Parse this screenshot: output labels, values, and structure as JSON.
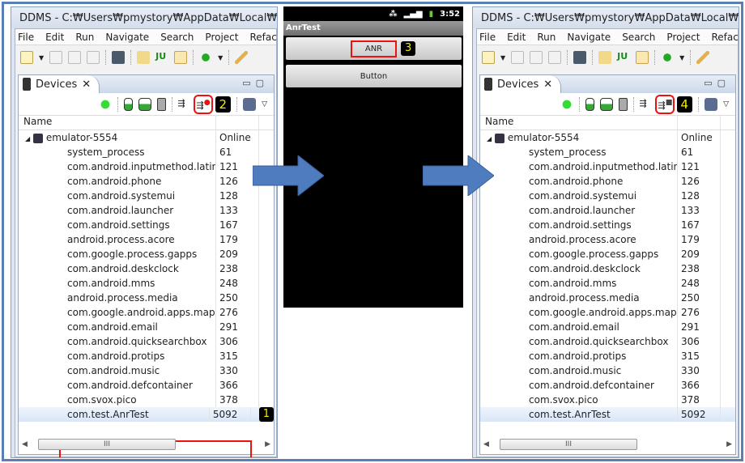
{
  "window": {
    "title": "DDMS - C:₩Users₩pmystory₩AppData₩Local₩Temp₩dd",
    "menu": [
      "File",
      "Edit",
      "Run",
      "Navigate",
      "Search",
      "Project",
      "Refactor"
    ],
    "devices_tab": "Devices",
    "column_name": "Name",
    "device": {
      "name": "emulator-5554",
      "status": "Online"
    },
    "processes": [
      [
        "system_process",
        "61"
      ],
      [
        "com.android.inputmethod.latin",
        "121"
      ],
      [
        "com.android.phone",
        "126"
      ],
      [
        "com.android.systemui",
        "128"
      ],
      [
        "com.android.launcher",
        "133"
      ],
      [
        "com.android.settings",
        "167"
      ],
      [
        "android.process.acore",
        "179"
      ],
      [
        "com.google.process.gapps",
        "209"
      ],
      [
        "com.android.deskclock",
        "238"
      ],
      [
        "com.android.mms",
        "248"
      ],
      [
        "android.process.media",
        "250"
      ],
      [
        "com.google.android.apps.maps:Fr",
        "276"
      ],
      [
        "com.android.email",
        "291"
      ],
      [
        "com.android.quicksearchbox",
        "306"
      ],
      [
        "com.android.protips",
        "315"
      ],
      [
        "com.android.music",
        "330"
      ],
      [
        "com.android.defcontainer",
        "366"
      ],
      [
        "com.svox.pico",
        "378"
      ],
      [
        "com.test.AnrTest",
        "5092"
      ]
    ],
    "scroll_thumb": "III"
  },
  "left": {
    "step_badge": "2",
    "row_badge": "1"
  },
  "right": {
    "step_badge": "4"
  },
  "phone": {
    "time": "3:52",
    "app_title": "AnrTest",
    "anr_button": "ANR",
    "step_badge": "3",
    "button2": "Button"
  },
  "colors": {
    "highlight": "#ee1111",
    "frame": "#5a7fb5",
    "arrow": "#4f7bbf"
  }
}
